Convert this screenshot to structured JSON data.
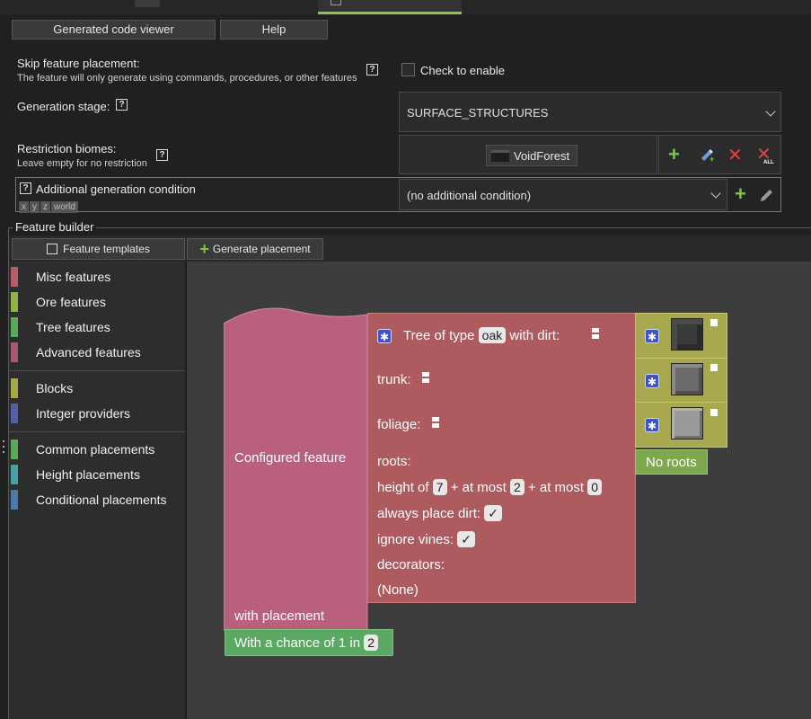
{
  "toolbar": {
    "code_viewer_label": "Generated code viewer",
    "help_label": "Help"
  },
  "skip_feature": {
    "label": "Skip feature placement:",
    "sublabel": "The feature will only generate using commands, procedures, or other features",
    "help": "?",
    "checkbox_label": "Check to enable"
  },
  "generation_stage": {
    "label": "Generation stage:",
    "help": "?",
    "value": "SURFACE_STRUCTURES"
  },
  "restriction_biomes": {
    "label": "Restriction biomes:",
    "sublabel": "Leave empty for no restriction",
    "help": "?",
    "biomes": [
      "VoidForest"
    ],
    "all_badge": "ALL"
  },
  "additional_condition": {
    "help": "?",
    "label": "Additional generation condition",
    "tags": [
      "x",
      "y",
      "z",
      "world"
    ],
    "value": "(no additional condition)"
  },
  "feature_builder": {
    "legend": "Feature builder",
    "templates_label": "Feature templates",
    "generate_label": "Generate placement",
    "categories": [
      {
        "label": "Misc features",
        "color": "#b35f66"
      },
      {
        "label": "Ore features",
        "color": "#8fb24a"
      },
      {
        "label": "Tree features",
        "color": "#5aa85a"
      },
      {
        "label": "Advanced features",
        "color": "#a85672"
      },
      {
        "label": "Blocks",
        "color": "#a5a84a"
      },
      {
        "label": "Integer providers",
        "color": "#5560a8"
      },
      {
        "label": "Common placements",
        "color": "#5aa85a"
      },
      {
        "label": "Height placements",
        "color": "#4aa0a0"
      },
      {
        "label": "Conditional placements",
        "color": "#4a7aa5"
      }
    ]
  },
  "blocks": {
    "configured_feature": "Configured feature",
    "with_placement": "with placement",
    "tree_prefix": "Tree of type",
    "tree_type": "oak",
    "tree_suffix": "with dirt:",
    "trunk": "trunk:",
    "foliage": "foliage:",
    "roots": "roots:",
    "no_roots": "No roots",
    "height_of": "height of",
    "height_base": "7",
    "plus_at_most_1": "+ at most",
    "height_rand_a": "2",
    "plus_at_most_2": "+ at most",
    "height_rand_b": "0",
    "always_place_dirt": "always place dirt:",
    "ignore_vines": "ignore vines:",
    "check": "✓",
    "decorators": "decorators:",
    "none": "(None)",
    "chance_prefix": "With a chance of 1 in",
    "chance_value": "2"
  }
}
